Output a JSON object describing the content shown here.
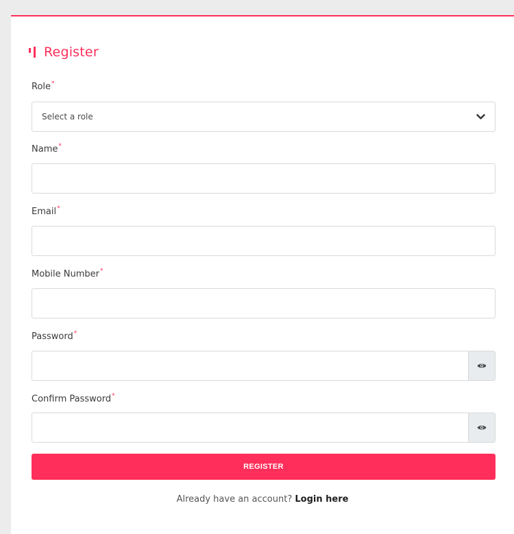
{
  "form": {
    "title": "Register",
    "fields": {
      "role": {
        "label": "Role",
        "required_mark": "*",
        "selected_value": "Select a role"
      },
      "name": {
        "label": "Name",
        "required_mark": "*",
        "value": ""
      },
      "email": {
        "label": "Email",
        "required_mark": "*",
        "value": ""
      },
      "mobile": {
        "label": "Mobile Number",
        "required_mark": "*",
        "value": ""
      },
      "password": {
        "label": "Password",
        "required_mark": "*",
        "value": "",
        "toggle_icon": "eye-icon"
      },
      "confirm_password": {
        "label": "Confirm Password",
        "required_mark": "*",
        "value": "",
        "toggle_icon": "eye-icon"
      }
    },
    "submit_label": "REGISTER",
    "footer": {
      "prompt": "Already have an account?",
      "link_text": "Login here"
    }
  },
  "colors": {
    "accent": "#ff2e5a",
    "page_background": "#ececec",
    "card_background": "#ffffff",
    "border": "#d9d9d9",
    "addon_background": "#e9ecef"
  }
}
